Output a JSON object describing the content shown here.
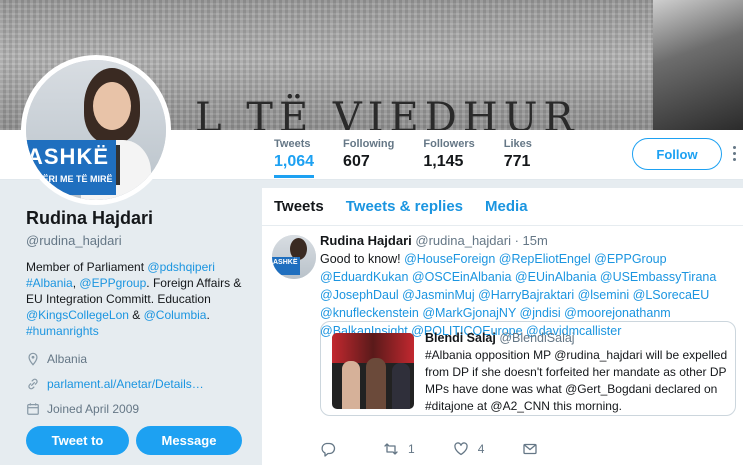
{
  "banner": {
    "text": "L TË VIEDHUR"
  },
  "avatar": {
    "sign_main": "ASHKË",
    "sign_sub": "QIPËRI ME TË MIRË",
    "mini_sign": "ASHKË"
  },
  "stats": [
    {
      "label": "Tweets",
      "value": "1,064"
    },
    {
      "label": "Following",
      "value": "607"
    },
    {
      "label": "Followers",
      "value": "1,145"
    },
    {
      "label": "Likes",
      "value": "771"
    }
  ],
  "follow_label": "Follow",
  "profile": {
    "name": "Rudina Hajdari",
    "handle": "@rudina_hajdari",
    "bio": {
      "t1": "Member of Parliament ",
      "l1": "@pdshqiperi",
      "l2": "#Albania",
      "t2": ", ",
      "l3": "@EPPgroup",
      "t3": ". Foreign Affairs & EU Integration Committ. Education ",
      "l4": "@KingsCollegeLon",
      "t4": " & ",
      "l5": "@Columbia",
      "t5": ".",
      "l6": "#humanrights"
    },
    "location": "Albania",
    "website": "parlament.al/Anetar/Details…",
    "joined": "Joined April 2009"
  },
  "buttons": {
    "tweet_to": "Tweet to",
    "message": "Message"
  },
  "tabs": [
    "Tweets",
    "Tweets & replies",
    "Media"
  ],
  "tweet": {
    "name": "Rudina Hajdari",
    "meta": "@rudina_hajdari · 15m",
    "intro": "Good to know! ",
    "mentions": "@HouseForeign @RepEliotEngel @EPPGroup @EduardKukan @OSCEinAlbania @EUinAlbania @USEmbassyTirana @JosephDaul @JasminMuj @HarryBajraktari @lsemini @LSorecaEU @knufleckenstein @MarkGjonajNY @jndisi @moorejonathanm @BalkanInsight @POLITICOEurope @davidmcallister"
  },
  "quote": {
    "name": "Blendi Salaj",
    "handle": "@BlendiSalaj",
    "text": "#Albania opposition MP @rudina_hajdari will be expelled from DP if she doesn't forfeited her mandate as other DP MPs have done was what @Gert_Bogdani declared on #ditajone at @A2_CNN this morning."
  },
  "actions": {
    "retweets": "1",
    "likes": "4"
  },
  "colors": {
    "accent": "#1da1f2",
    "link": "#1b95e0",
    "sign": "#1f6fbf"
  }
}
